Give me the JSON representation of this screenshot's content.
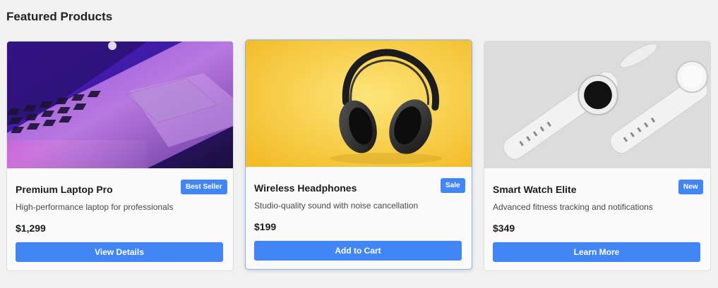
{
  "section": {
    "title": "Featured Products"
  },
  "products": [
    {
      "image_icon": "laptop-image",
      "title": "Premium Laptop Pro",
      "badge": "Best Seller",
      "description": "High-performance laptop for professionals",
      "price": "$1,299",
      "button_label": "View Details"
    },
    {
      "image_icon": "headphones-image",
      "title": "Wireless Headphones",
      "badge": "Sale",
      "description": "Studio-quality sound with noise cancellation",
      "price": "$199",
      "button_label": "Add to Cart"
    },
    {
      "image_icon": "smartwatch-image",
      "title": "Smart Watch Elite",
      "badge": "New",
      "description": "Advanced fitness tracking and notifications",
      "price": "$349",
      "button_label": "Learn More"
    }
  ],
  "colors": {
    "accent": "#4285f4",
    "background": "#f1f1f1",
    "card": "#fafafa",
    "highlight_border": "#8ab0ee"
  }
}
